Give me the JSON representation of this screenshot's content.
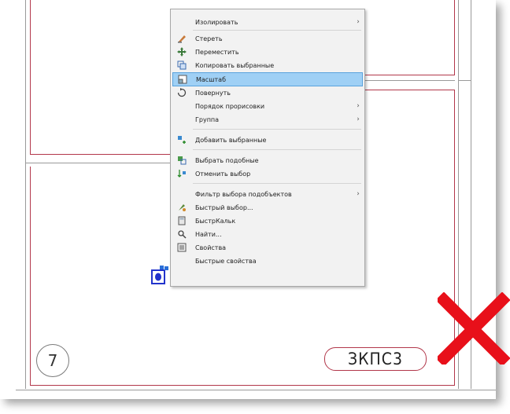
{
  "drawing": {
    "circle_number": "7",
    "label": "ЗКПС3"
  },
  "context_menu": {
    "items": [
      {
        "label": "Изолировать",
        "icon": "none",
        "submenu": true
      },
      {
        "label": "Стереть",
        "icon": "eraser-icon",
        "submenu": false
      },
      {
        "label": "Переместить",
        "icon": "move-icon",
        "submenu": false
      },
      {
        "label": "Копировать выбранные",
        "icon": "copy-icon",
        "submenu": false
      },
      {
        "label": "Масштаб",
        "icon": "scale-icon",
        "submenu": false,
        "highlighted": true
      },
      {
        "label": "Повернуть",
        "icon": "rotate-icon",
        "submenu": false
      },
      {
        "label": "Порядок прорисовки",
        "icon": "none",
        "submenu": true
      },
      {
        "label": "Группа",
        "icon": "none",
        "submenu": true
      },
      {
        "label": "Добавить выбранные",
        "icon": "add-selected-icon",
        "submenu": false
      },
      {
        "label": "Выбрать подобные",
        "icon": "select-similar-icon",
        "submenu": false
      },
      {
        "label": "Отменить выбор",
        "icon": "deselect-icon",
        "submenu": false
      },
      {
        "label": "Фильтр выбора подобъектов",
        "icon": "none",
        "submenu": true
      },
      {
        "label": "Быстрый выбор...",
        "icon": "quick-select-icon",
        "submenu": false
      },
      {
        "label": "БыстрКальк",
        "icon": "calculator-icon",
        "submenu": false
      },
      {
        "label": "Найти...",
        "icon": "find-icon",
        "submenu": false
      },
      {
        "label": "Свойства",
        "icon": "properties-icon",
        "submenu": false
      },
      {
        "label": "Быстрые свойства",
        "icon": "none",
        "submenu": false
      }
    ]
  },
  "colors": {
    "frame_red": "#b2374a",
    "highlight": "#9fd0f5",
    "cross": "#e8101a"
  }
}
